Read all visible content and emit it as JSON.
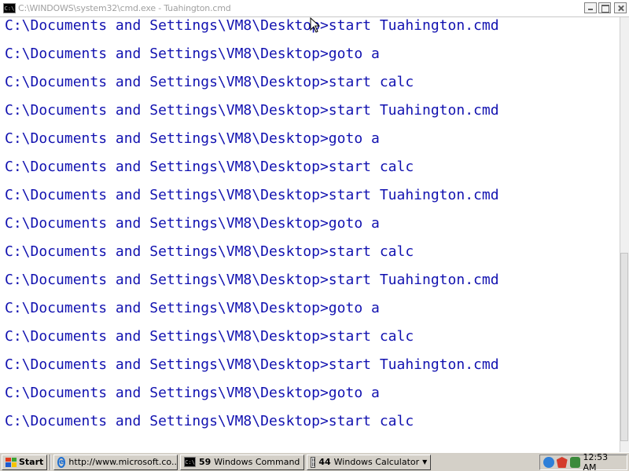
{
  "window": {
    "title": "C:\\WINDOWS\\system32\\cmd.exe - Tuahington.cmd",
    "icon_label": "C:\\"
  },
  "console": {
    "lines": [
      "C:\\Documents and Settings\\VM8\\Desktop>start Tuahington.cmd",
      "C:\\Documents and Settings\\VM8\\Desktop>goto a",
      "C:\\Documents and Settings\\VM8\\Desktop>start calc",
      "C:\\Documents and Settings\\VM8\\Desktop>start Tuahington.cmd",
      "C:\\Documents and Settings\\VM8\\Desktop>goto a",
      "C:\\Documents and Settings\\VM8\\Desktop>start calc",
      "C:\\Documents and Settings\\VM8\\Desktop>start Tuahington.cmd",
      "C:\\Documents and Settings\\VM8\\Desktop>goto a",
      "C:\\Documents and Settings\\VM8\\Desktop>start calc",
      "C:\\Documents and Settings\\VM8\\Desktop>start Tuahington.cmd",
      "C:\\Documents and Settings\\VM8\\Desktop>goto a",
      "C:\\Documents and Settings\\VM8\\Desktop>start calc",
      "C:\\Documents and Settings\\VM8\\Desktop>start Tuahington.cmd",
      "C:\\Documents and Settings\\VM8\\Desktop>goto a",
      "C:\\Documents and Settings\\VM8\\Desktop>start calc"
    ],
    "text_color": "#1212b0",
    "background_color": "#ffffff"
  },
  "taskbar": {
    "start_label": "Start",
    "tasks": [
      {
        "icon": "ie-icon",
        "count": "",
        "label": "http://www.microsoft.co..."
      },
      {
        "icon": "cmd-icon",
        "count": "59",
        "label": "Windows Command ..."
      },
      {
        "icon": "calc-icon",
        "count": "44",
        "label": "Windows Calculator"
      }
    ],
    "tray_icons": [
      "network-icon",
      "security-icon",
      "volume-icon"
    ],
    "clock": "12:53 AM"
  }
}
